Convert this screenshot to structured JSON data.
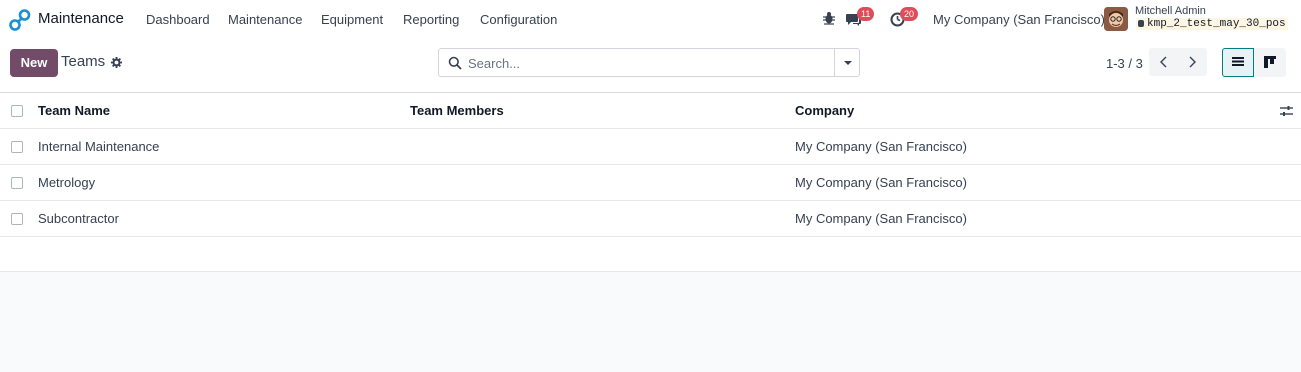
{
  "navbar": {
    "brand": "Maintenance",
    "menu": [
      "Dashboard",
      "Maintenance",
      "Equipment",
      "Reporting",
      "Configuration"
    ],
    "messages_count": "11",
    "activities_count": "20",
    "company": "My Company (San Francisco)",
    "user_name": "Mitchell Admin",
    "database": "kmp_2_test_may_30_pos"
  },
  "control": {
    "new_label": "New",
    "breadcrumb": "Teams",
    "search_placeholder": "Search...",
    "pager": "1-3 / 3"
  },
  "table": {
    "columns": [
      "Team Name",
      "Team Members",
      "Company"
    ],
    "rows": [
      {
        "name": "Internal Maintenance",
        "members": "",
        "company": "My Company (San Francisco)"
      },
      {
        "name": "Metrology",
        "members": "",
        "company": "My Company (San Francisco)"
      },
      {
        "name": "Subcontractor",
        "members": "",
        "company": "My Company (San Francisco)"
      }
    ]
  },
  "colors": {
    "primary": "#714b67",
    "accent": "#017e84",
    "badge": "#e04c5a"
  }
}
